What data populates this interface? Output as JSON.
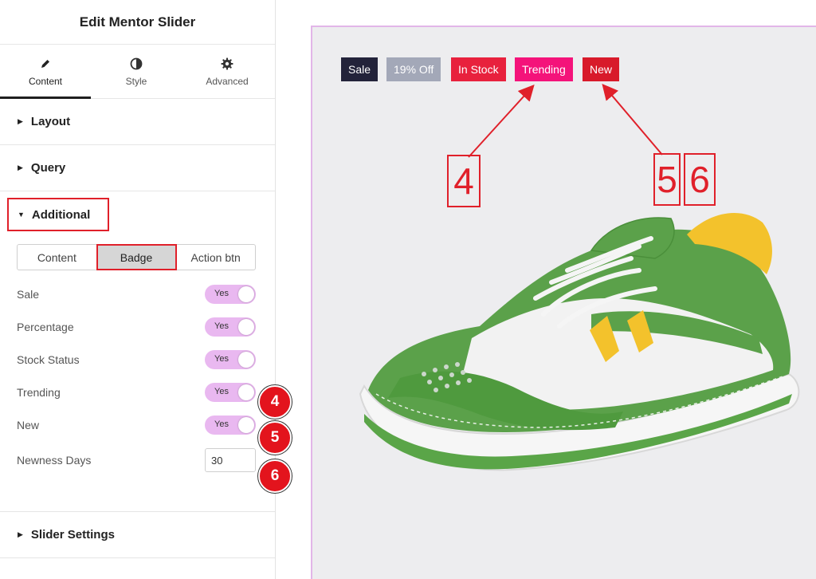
{
  "panel": {
    "title": "Edit Mentor Slider",
    "tabs": [
      {
        "label": "Content",
        "icon": "pencil-icon"
      },
      {
        "label": "Style",
        "icon": "half-circle-icon"
      },
      {
        "label": "Advanced",
        "icon": "gear-icon"
      }
    ],
    "sections": {
      "layout": "Layout",
      "query": "Query",
      "additional": "Additional",
      "slider_settings": "Slider Settings"
    },
    "subtabs": [
      "Content",
      "Badge",
      "Action btn"
    ],
    "controls": {
      "sale": {
        "label": "Sale",
        "value": "Yes"
      },
      "percentage": {
        "label": "Percentage",
        "value": "Yes"
      },
      "stock_status": {
        "label": "Stock Status",
        "value": "Yes"
      },
      "trending": {
        "label": "Trending",
        "value": "Yes"
      },
      "new": {
        "label": "New",
        "value": "Yes"
      },
      "newness_days": {
        "label": "Newness Days",
        "value": "30"
      }
    },
    "callouts": [
      "4",
      "5",
      "6"
    ]
  },
  "preview": {
    "badges": [
      {
        "label": "Sale",
        "color": "#23233a"
      },
      {
        "label": "19% Off",
        "color": "#a3a8b8"
      },
      {
        "label": "In Stock",
        "color": "#e8213d"
      },
      {
        "label": "Trending",
        "color": "#f4137a"
      },
      {
        "label": "New",
        "color": "#d81a2a"
      }
    ],
    "annotations": [
      "4",
      "5",
      "6"
    ]
  },
  "colors": {
    "accent_red": "#e0202a",
    "toggle_bg": "#e9b8f0",
    "preview_border": "#e2b6e8",
    "shoe_green": "#58a445"
  }
}
